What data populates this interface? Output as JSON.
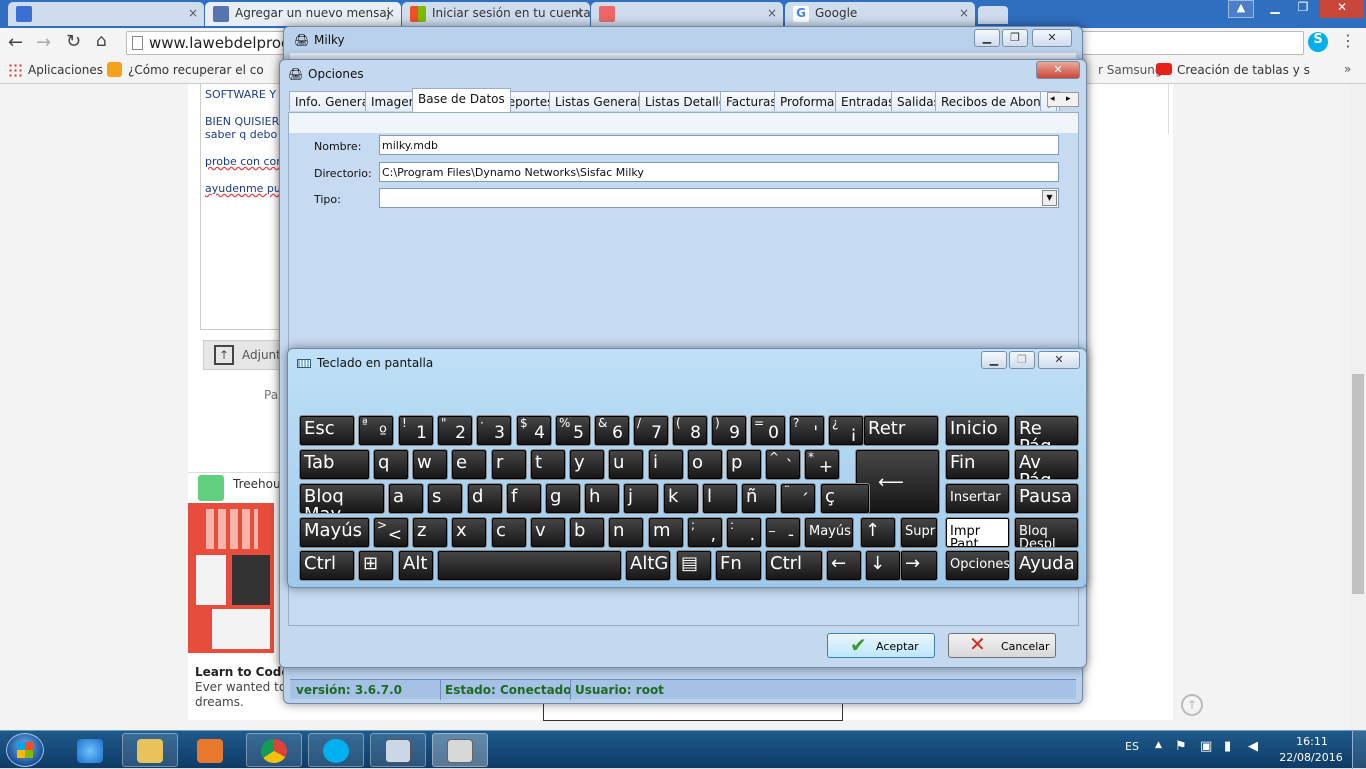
{
  "browser": {
    "tabs": [
      {
        "label": "",
        "close": "×"
      },
      {
        "label": "Agregar un nuevo mensaj",
        "close": "×"
      },
      {
        "label": "Iniciar sesión en tu cuenta",
        "close": "×"
      },
      {
        "label": "",
        "close": "×"
      },
      {
        "label": "Google",
        "close": "×"
      }
    ],
    "url": "www.lawebdelprog",
    "bookmarks": [
      {
        "label": "Aplicaciones"
      },
      {
        "label": "¿Cómo recuperar el co"
      },
      {
        "label": "r Samsung"
      },
      {
        "label": "Creación de tablas y s"
      }
    ]
  },
  "page": {
    "text_lines": [
      "SOFTWARE Y",
      "BIEN QUISIER",
      "saber q debo",
      "probe con cor",
      "ayudenme pu"
    ],
    "attach_label": "Adjunt",
    "pa_label": "Pa",
    "ad_title": "Treehou",
    "ad_heading": "Learn to Code",
    "ad_text1": "Ever wanted to b",
    "ad_text2": "dreams."
  },
  "milky": {
    "title": "Milky",
    "status": {
      "version": "versión: 3.6.7.0",
      "estado": "Estado: Conectado",
      "usuario": "Usuario: root"
    }
  },
  "opciones": {
    "title": "Opciones",
    "close": "✕",
    "tabs": [
      "Info. General",
      "Imagen",
      "Base de Datos",
      "Reportes",
      "Listas Generales",
      "Listas Detalles",
      "Facturas",
      "Proformas",
      "Entradas",
      "Salidas",
      "Recibos de Abonos",
      "("
    ],
    "fields": {
      "nombre_label": "Nombre:",
      "nombre_value": "milky.mdb",
      "directorio_label": "Directorio:",
      "directorio_value": "C:\\Program Files\\Dynamo Networks\\Sisfac Milky",
      "tipo_label": "Tipo:",
      "tipo_value": ""
    },
    "aceptar": "Aceptar",
    "cancelar": "Cancelar"
  },
  "osk": {
    "title": "Teclado en pantalla",
    "rows": [
      [
        {
          "l": "Esc"
        },
        {
          "s": "ª",
          "l": "º"
        },
        {
          "s": "!",
          "l": "1"
        },
        {
          "s": "\"",
          "l": "2"
        },
        {
          "s": "·",
          "l": "3"
        },
        {
          "s": "$",
          "l": "4"
        },
        {
          "s": "%",
          "l": "5"
        },
        {
          "s": "&",
          "l": "6"
        },
        {
          "s": "/",
          "l": "7"
        },
        {
          "s": "(",
          "l": "8"
        },
        {
          "s": ")",
          "l": "9"
        },
        {
          "s": "=",
          "l": "0"
        },
        {
          "s": "?",
          "l": "'"
        },
        {
          "s": "¿",
          "l": "¡"
        },
        {
          "l": "Retr"
        },
        {
          "l": "Inicio"
        },
        {
          "l": "Re Pág"
        }
      ],
      [
        {
          "l": "Tab"
        },
        {
          "l": "q"
        },
        {
          "l": "w"
        },
        {
          "l": "e"
        },
        {
          "l": "r"
        },
        {
          "l": "t"
        },
        {
          "l": "y"
        },
        {
          "l": "u"
        },
        {
          "l": "i"
        },
        {
          "l": "o"
        },
        {
          "l": "p"
        },
        {
          "s": "^",
          "l": "`"
        },
        {
          "s": "*",
          "l": "+"
        },
        {
          "l": "⟵"
        },
        {
          "l": "Fin"
        },
        {
          "l": "Av Pág"
        }
      ],
      [
        {
          "l": "Bloq May"
        },
        {
          "l": "a"
        },
        {
          "l": "s"
        },
        {
          "l": "d"
        },
        {
          "l": "f"
        },
        {
          "l": "g"
        },
        {
          "l": "h"
        },
        {
          "l": "j"
        },
        {
          "l": "k"
        },
        {
          "l": "l"
        },
        {
          "l": "ñ"
        },
        {
          "s": "¨",
          "l": "´"
        },
        {
          "l": "ç"
        },
        {
          "l": "Insertar"
        },
        {
          "l": "Pausa"
        }
      ],
      [
        {
          "l": "Mayús"
        },
        {
          "s": ">",
          "l": "<"
        },
        {
          "l": "z"
        },
        {
          "l": "x"
        },
        {
          "l": "c"
        },
        {
          "l": "v"
        },
        {
          "l": "b"
        },
        {
          "l": "n"
        },
        {
          "l": "m"
        },
        {
          "s": ";",
          "l": ","
        },
        {
          "s": ":",
          "l": "."
        },
        {
          "s": "_",
          "l": "-"
        },
        {
          "l": "Mayús"
        },
        {
          "l": "↑"
        },
        {
          "l": "Supr"
        },
        {
          "l": "Impr Pant"
        },
        {
          "l": "Bloq Despl"
        }
      ],
      [
        {
          "l": "Ctrl"
        },
        {
          "l": "⊞"
        },
        {
          "l": "Alt"
        },
        {
          "l": ""
        },
        {
          "l": "AltGr"
        },
        {
          "l": "▤"
        },
        {
          "l": "Fn"
        },
        {
          "l": "Ctrl"
        },
        {
          "l": "←"
        },
        {
          "l": "↓"
        },
        {
          "l": "→"
        },
        {
          "l": "Opciones"
        },
        {
          "l": "Ayuda"
        }
      ]
    ]
  },
  "taskbar": {
    "lang": "ES",
    "time": "16:11",
    "date": "22/08/2016"
  }
}
